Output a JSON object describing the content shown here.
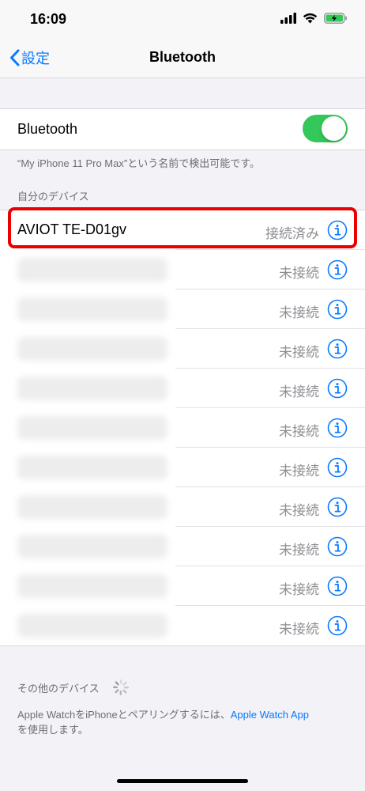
{
  "status_bar": {
    "time": "16:09",
    "battery_color": "#34c759"
  },
  "nav": {
    "back_label": "設定",
    "title": "Bluetooth"
  },
  "bluetooth_toggle": {
    "label": "Bluetooth",
    "on": true,
    "color": "#34c759"
  },
  "discoverable_note": "“My iPhone 11 Pro Max”という名前で検出可能です。",
  "my_devices": {
    "header": "自分のデバイス",
    "items": [
      {
        "name": "AVIOT TE-D01gv",
        "status": "接続済み",
        "highlighted": true
      },
      {
        "name": "",
        "status": "未接続"
      },
      {
        "name": "",
        "status": "未接続"
      },
      {
        "name": "",
        "status": "未接続"
      },
      {
        "name": "",
        "status": "未接続"
      },
      {
        "name": "",
        "status": "未接続"
      },
      {
        "name": "",
        "status": "未接続"
      },
      {
        "name": "",
        "status": "未接続"
      },
      {
        "name": "",
        "status": "未接続"
      },
      {
        "name": "",
        "status": "未接続"
      },
      {
        "name": "",
        "status": "未接続"
      }
    ]
  },
  "other_devices": {
    "header": "その他のデバイス"
  },
  "pairing_note": {
    "text": "Apple WatchをiPhoneとペアリングするには、",
    "link": "Apple Watch App",
    "suffix": "を使用します。"
  },
  "colors": {
    "accent": "#0a7aff",
    "highlight": "#ea0000",
    "secondary_text": "#8e8e93"
  }
}
